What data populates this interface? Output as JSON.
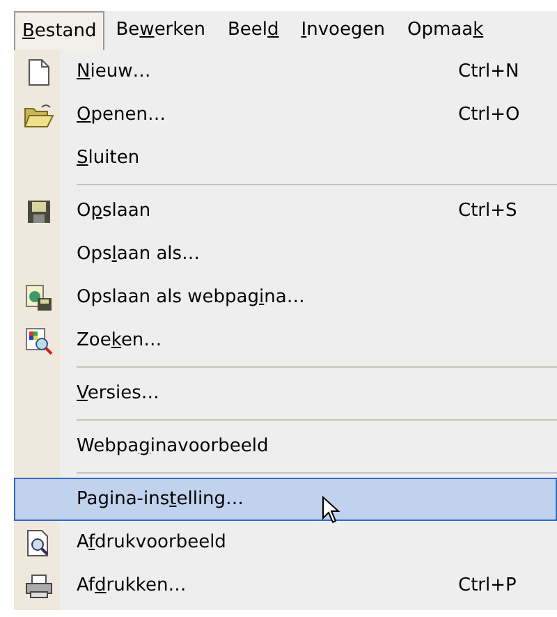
{
  "menubar": [
    {
      "label": {
        "key": "B",
        "post": "estand"
      },
      "selected": true
    },
    {
      "label": {
        "pre": "Be",
        "key": "w",
        "post": "erken"
      },
      "selected": false
    },
    {
      "label": {
        "pre": "Beel",
        "key": "d"
      },
      "selected": false
    },
    {
      "label": {
        "key": "I",
        "post": "nvoegen"
      },
      "selected": false
    },
    {
      "label": {
        "pre": "Opmaa",
        "key": "k"
      },
      "selected": false
    }
  ],
  "menu": [
    {
      "kind": "item",
      "label": {
        "key": "N",
        "post": "ieuw…"
      },
      "shortcut": "Ctrl+N",
      "selected": false
    },
    {
      "kind": "item",
      "label": {
        "key": "O",
        "post": "penen…"
      },
      "shortcut": "Ctrl+O",
      "selected": false
    },
    {
      "kind": "item",
      "label": {
        "key": "S",
        "post": "luiten"
      },
      "selected": false
    },
    {
      "kind": "separator"
    },
    {
      "kind": "item",
      "label": {
        "pre": "O",
        "key": "p",
        "post": "slaan"
      },
      "shortcut": "Ctrl+S",
      "selected": false
    },
    {
      "kind": "item",
      "label": {
        "pre": "Ops",
        "key": "l",
        "post": "aan als…"
      },
      "selected": false
    },
    {
      "kind": "item",
      "label": {
        "pre": "Opslaan als webpag",
        "key": "i",
        "post": "na…"
      },
      "selected": false
    },
    {
      "kind": "item",
      "label": {
        "pre": "Zoe",
        "key": "k",
        "post": "en…"
      },
      "selected": false
    },
    {
      "kind": "separator"
    },
    {
      "kind": "item",
      "label": {
        "key": "V",
        "post": "ersies…"
      },
      "selected": false
    },
    {
      "kind": "separator"
    },
    {
      "kind": "item",
      "label": {
        "pre": "Webpa",
        "key": "g",
        "post": "inavoorbeeld"
      },
      "selected": false
    },
    {
      "kind": "separator"
    },
    {
      "kind": "item",
      "label": {
        "pre": "Pagina-ins",
        "key": "t",
        "post": "elling…"
      },
      "selected": true
    },
    {
      "kind": "item",
      "label": {
        "pre": "A",
        "key": "f",
        "post": "drukvoorbeeld"
      },
      "selected": false
    },
    {
      "kind": "item",
      "label": {
        "pre": "Af",
        "key": "d",
        "post": "rukken…"
      },
      "shortcut": "Ctrl+P",
      "selected": false
    }
  ]
}
